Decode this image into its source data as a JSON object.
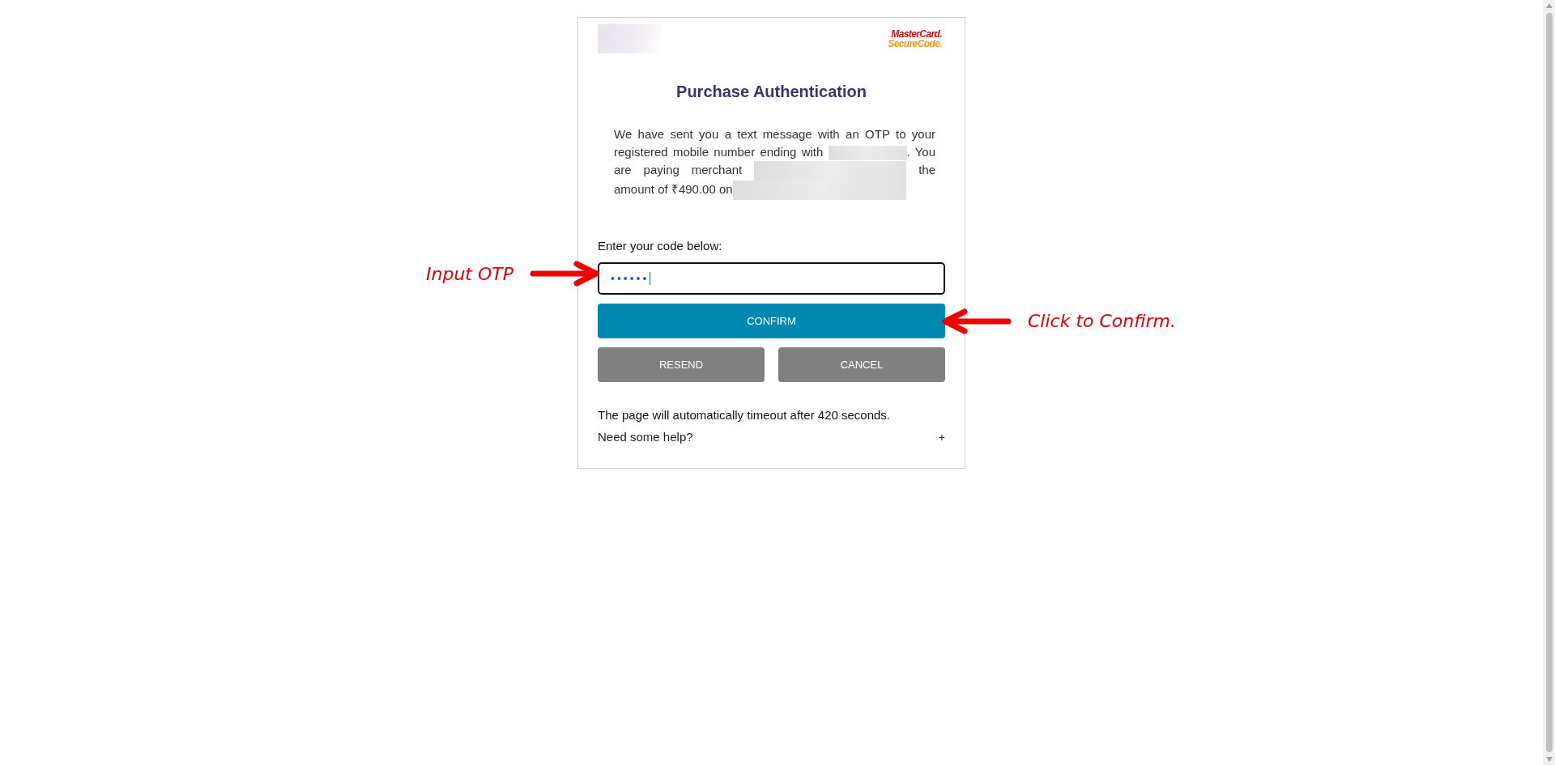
{
  "header": {
    "logo_lines": [
      "MasterCard.",
      "SecureCode."
    ]
  },
  "title": "Purchase Authentication",
  "message": [
    {
      "kind": "text",
      "text": "We have sent you a text message with an OTP to your registered mobile number ending with "
    },
    {
      "kind": "redacted"
    },
    {
      "kind": "text",
      "text": ". You are paying merchant "
    },
    {
      "kind": "redacted"
    },
    {
      "kind": "text",
      "text": " the amount of ₹490.00 on"
    },
    {
      "kind": "redacted"
    }
  ],
  "code_field": {
    "label": "Enter your code below:",
    "value": "••••••"
  },
  "buttons": [
    {
      "label": "CONFIRM",
      "kind": "primary"
    },
    {
      "label": "RESEND",
      "kind": "secondary"
    },
    {
      "label": "CANCEL",
      "kind": "secondary"
    }
  ],
  "timeout_text": "The page will automatically timeout after 420 seconds.",
  "help": {
    "label": "Need some help?",
    "toggle": "+",
    "expanded": false
  },
  "annotations": [
    {
      "text": "Input OTP"
    },
    {
      "text": "Click to Confirm."
    }
  ]
}
